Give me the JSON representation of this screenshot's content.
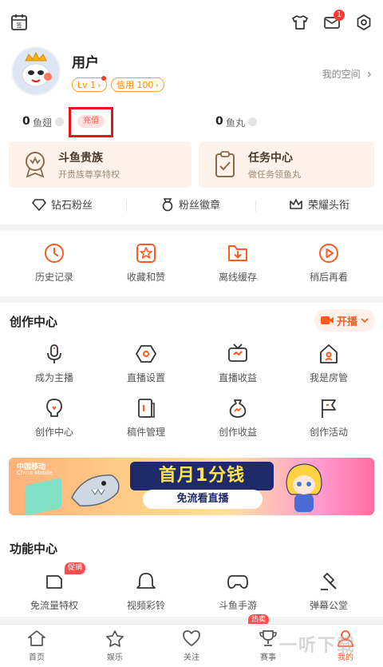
{
  "header": {
    "notification_count": "1"
  },
  "profile": {
    "username": "用户",
    "level_label": "Lv 1",
    "credit_label": "信用 100",
    "my_space": "我的空间"
  },
  "stats": {
    "fish_wing_count": "0",
    "fish_wing_label": "鱼翅",
    "recharge_label": "充值",
    "fish_ball_count": "0",
    "fish_ball_label": "鱼丸"
  },
  "cards": [
    {
      "title": "斗鱼贵族",
      "subtitle": "开贵族尊享特权"
    },
    {
      "title": "任务中心",
      "subtitle": "做任务领鱼丸"
    }
  ],
  "fan_row": [
    {
      "label": "钻石粉丝"
    },
    {
      "label": "粉丝徽章"
    },
    {
      "label": "荣耀头衔"
    }
  ],
  "quick_actions": [
    {
      "label": "历史记录"
    },
    {
      "label": "收藏和赞"
    },
    {
      "label": "离线缓存"
    },
    {
      "label": "稍后再看"
    }
  ],
  "creation": {
    "title": "创作中心",
    "live_button": "开播",
    "items": [
      {
        "label": "成为主播"
      },
      {
        "label": "直播设置"
      },
      {
        "label": "直播收益"
      },
      {
        "label": "我是房管"
      },
      {
        "label": "创作中心"
      },
      {
        "label": "稿件管理"
      },
      {
        "label": "创作收益"
      },
      {
        "label": "创作活动"
      }
    ]
  },
  "banner": {
    "brand": "中国移动",
    "brand_en": "China Mobile",
    "title": "首月1分钱",
    "subtitle": "免流看直播"
  },
  "functions": {
    "title": "功能中心",
    "promo_tag": "促销",
    "items": [
      {
        "label": "免流量特权"
      },
      {
        "label": "视频彩铃"
      },
      {
        "label": "斗鱼手游"
      },
      {
        "label": "弹幕公堂"
      }
    ]
  },
  "tabbar": {
    "hot_tag": "热卖",
    "items": [
      {
        "label": "首页"
      },
      {
        "label": "娱乐"
      },
      {
        "label": "关注"
      },
      {
        "label": "赛事"
      },
      {
        "label": "我的"
      }
    ]
  },
  "watermark": "一听下载",
  "colors": {
    "accent": "#ff5a1f",
    "highlight_box": "#e8141a"
  }
}
